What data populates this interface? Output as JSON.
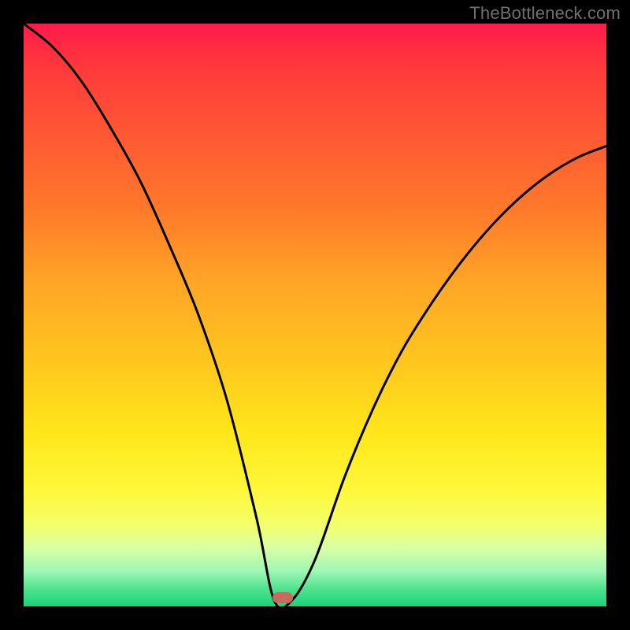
{
  "watermark": "TheBottleneck.com",
  "gradient": {
    "stops": [
      "#ff1a4a",
      "#ff3b3b",
      "#ff5a33",
      "#ff7a2a",
      "#ffa726",
      "#ffc61e",
      "#ffe61a",
      "#fff73a",
      "#f4ff6a",
      "#d8ffa5",
      "#9cf7b4",
      "#4fe38f",
      "#16d47a"
    ]
  },
  "marker": {
    "x_frac": 0.445,
    "y_frac": 0.985,
    "color": "#c96a5e"
  },
  "chart_data": {
    "type": "line",
    "title": "",
    "xlabel": "",
    "ylabel": "",
    "xlim": [
      0,
      1
    ],
    "ylim": [
      0,
      1
    ],
    "notes": "No axis ticks, labels, or legend are shown. Background is a heatmap-style vertical gradient (red top → green bottom). A single black curve descends steeply from top-left, reaches ~0 near x≈0.44 (flat notch), then rises to the right. A small rounded marker sits at the minimum.",
    "series": [
      {
        "name": "curve",
        "x": [
          0.0,
          0.05,
          0.1,
          0.15,
          0.2,
          0.25,
          0.3,
          0.35,
          0.4,
          0.43,
          0.46,
          0.5,
          0.55,
          0.6,
          0.65,
          0.7,
          0.75,
          0.8,
          0.85,
          0.9,
          0.95,
          1.0
        ],
        "values": [
          1.0,
          0.96,
          0.9,
          0.82,
          0.73,
          0.62,
          0.5,
          0.35,
          0.15,
          0.01,
          0.01,
          0.08,
          0.22,
          0.34,
          0.44,
          0.52,
          0.59,
          0.65,
          0.7,
          0.74,
          0.77,
          0.79
        ]
      }
    ],
    "marker_point": {
      "x": 0.445,
      "y": 0.015
    }
  }
}
